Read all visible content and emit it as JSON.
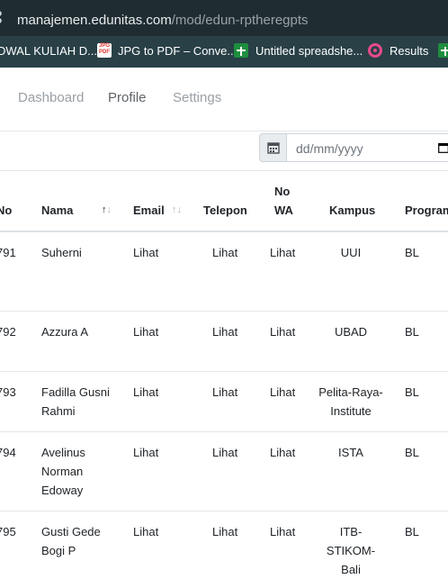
{
  "browser": {
    "url_domain": "manajemen.edunitas.com",
    "url_path": "/mod/edun-rptheregpts",
    "bookmarks": [
      {
        "label": "DWAL KULIAH D...",
        "icon": "none"
      },
      {
        "label": "JPG to PDF – Conve...",
        "icon": "jpg-pdf-icon"
      },
      {
        "label": "Untitled spreadshe...",
        "icon": "sheets-icon"
      },
      {
        "label": "Results",
        "icon": "results-logo-icon"
      },
      {
        "label": "",
        "icon": "sheets-icon"
      }
    ]
  },
  "nav": {
    "items": [
      {
        "label": "Dashboard"
      },
      {
        "label": "Profile"
      },
      {
        "label": "Settings"
      }
    ]
  },
  "filter": {
    "date_placeholder": "dd/mm/yyyy"
  },
  "table": {
    "headers": {
      "no": "No",
      "nama": "Nama",
      "email": "Email",
      "telepon": "Telepon",
      "no_wa": [
        "No",
        "WA"
      ],
      "kampus": "Kampus",
      "program": "Program"
    },
    "rows": [
      {
        "no": "791",
        "nama": [
          "Suherni"
        ],
        "email": "Lihat",
        "telepon": "Lihat",
        "wa": "Lihat",
        "kampus": [
          "UUI"
        ],
        "program": "BL"
      },
      {
        "no": "792",
        "nama": [
          "Azzura A"
        ],
        "email": "Lihat",
        "telepon": "Lihat",
        "wa": "Lihat",
        "kampus": [
          "UBAD"
        ],
        "program": "BL"
      },
      {
        "no": "793",
        "nama": [
          "Fadilla Gusni",
          "Rahmi"
        ],
        "email": "Lihat",
        "telepon": "Lihat",
        "wa": "Lihat",
        "kampus": [
          "Pelita-Raya-",
          "Institute"
        ],
        "program": "BL"
      },
      {
        "no": "794",
        "nama": [
          "Avelinus",
          "Norman",
          "Edoway"
        ],
        "email": "Lihat",
        "telepon": "Lihat",
        "wa": "Lihat",
        "kampus": [
          "ISTA"
        ],
        "program": "BL"
      },
      {
        "no": "795",
        "nama": [
          "Gusti Gede",
          "Bogi P"
        ],
        "email": "Lihat",
        "telepon": "Lihat",
        "wa": "Lihat",
        "kampus": [
          "ITB-",
          "STIKOM-",
          "Bali"
        ],
        "program": "BL"
      }
    ]
  },
  "colors": {
    "address_bar_bg": "#1f2d32",
    "bookmarks_bar_bg": "#284046",
    "border": "#dee2e6",
    "text": "#212529",
    "muted_nav": "#9aa0a6"
  }
}
